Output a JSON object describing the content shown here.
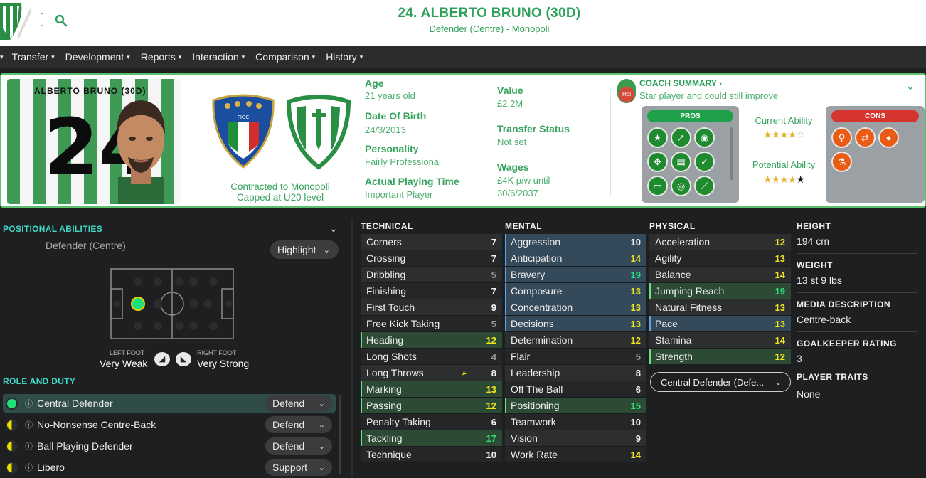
{
  "header": {
    "title": "24. ALBERTO BRUNO (30D)",
    "subtitle": "Defender (Centre) - Monopoli"
  },
  "nav": [
    "Transfer",
    "Development",
    "Reports",
    "Interaction",
    "Comparison",
    "History"
  ],
  "profile": {
    "photo_name": "ALBERTO BRUNO (30D)",
    "shirt_number": "24",
    "contract": "Contracted to Monopoli",
    "capped": "Capped at U20 level",
    "age_label": "Age",
    "age": "21 years old",
    "dob_label": "Date Of Birth",
    "dob": "24/3/2013",
    "personality_label": "Personality",
    "personality": "Fairly Professional",
    "apt_label": "Actual Playing Time",
    "apt": "Important Player",
    "value_label": "Value",
    "value": "£2.2M",
    "transfer_label": "Transfer Status",
    "transfer": "Not set",
    "wages_label": "Wages",
    "wages": "£4K p/w until",
    "wages_until": "30/6/2037"
  },
  "coach": {
    "title": "COACH SUMMARY",
    "badge": "Hol",
    "summary": "Star player and could still improve",
    "pros_label": "PROS",
    "cons_label": "CONS",
    "current_ability_label": "Current Ability",
    "potential_ability_label": "Potential Ability",
    "current_ability_stars": 3.5,
    "potential_ability_stars": 4.0
  },
  "positional": {
    "title": "POSITIONAL ABILITIES",
    "position": "Defender (Centre)",
    "highlight": "Highlight",
    "left_foot_label": "LEFT FOOT",
    "left_foot": "Very Weak",
    "right_foot_label": "RIGHT FOOT",
    "right_foot": "Very Strong"
  },
  "roles": {
    "title": "ROLE AND DUTY",
    "items": [
      {
        "name": "Central Defender",
        "duty": "Defend"
      },
      {
        "name": "No-Nonsense Centre-Back",
        "duty": "Defend"
      },
      {
        "name": "Ball Playing Defender",
        "duty": "Defend"
      },
      {
        "name": "Libero",
        "duty": "Support"
      }
    ]
  },
  "technical": {
    "title": "TECHNICAL",
    "rows": [
      {
        "name": "Corners",
        "value": "7"
      },
      {
        "name": "Crossing",
        "value": "7"
      },
      {
        "name": "Dribbling",
        "value": "5"
      },
      {
        "name": "Finishing",
        "value": "7"
      },
      {
        "name": "First Touch",
        "value": "9"
      },
      {
        "name": "Free Kick Taking",
        "value": "5"
      },
      {
        "name": "Heading",
        "value": "12"
      },
      {
        "name": "Long Shots",
        "value": "4"
      },
      {
        "name": "Long Throws",
        "value": "8"
      },
      {
        "name": "Marking",
        "value": "13"
      },
      {
        "name": "Passing",
        "value": "12"
      },
      {
        "name": "Penalty Taking",
        "value": "6"
      },
      {
        "name": "Tackling",
        "value": "17"
      },
      {
        "name": "Technique",
        "value": "10"
      }
    ]
  },
  "mental": {
    "title": "MENTAL",
    "rows": [
      {
        "name": "Aggression",
        "value": "10"
      },
      {
        "name": "Anticipation",
        "value": "14"
      },
      {
        "name": "Bravery",
        "value": "19"
      },
      {
        "name": "Composure",
        "value": "13"
      },
      {
        "name": "Concentration",
        "value": "13"
      },
      {
        "name": "Decisions",
        "value": "13"
      },
      {
        "name": "Determination",
        "value": "12"
      },
      {
        "name": "Flair",
        "value": "5"
      },
      {
        "name": "Leadership",
        "value": "8"
      },
      {
        "name": "Off The Ball",
        "value": "6"
      },
      {
        "name": "Positioning",
        "value": "15"
      },
      {
        "name": "Teamwork",
        "value": "10"
      },
      {
        "name": "Vision",
        "value": "9"
      },
      {
        "name": "Work Rate",
        "value": "14"
      }
    ]
  },
  "physical": {
    "title": "PHYSICAL",
    "rows": [
      {
        "name": "Acceleration",
        "value": "12"
      },
      {
        "name": "Agility",
        "value": "13"
      },
      {
        "name": "Balance",
        "value": "14"
      },
      {
        "name": "Jumping Reach",
        "value": "19"
      },
      {
        "name": "Natural Fitness",
        "value": "13"
      },
      {
        "name": "Pace",
        "value": "13"
      },
      {
        "name": "Stamina",
        "value": "14"
      },
      {
        "name": "Strength",
        "value": "12"
      }
    ],
    "role_select": "Central Defender (Defe..."
  },
  "info": {
    "height_label": "HEIGHT",
    "height": "194 cm",
    "weight_label": "WEIGHT",
    "weight": "13 st 9 lbs",
    "media_label": "MEDIA DESCRIPTION",
    "media": "Centre-back",
    "gk_label": "GOALKEEPER RATING",
    "gk": "3",
    "traits_label": "PLAYER TRAITS",
    "traits": "None"
  },
  "colors": {
    "brand_green": "#2fa15a",
    "accent_teal": "#3fd8c6",
    "pros": "#1f8a2e",
    "cons": "#ea5b16"
  }
}
